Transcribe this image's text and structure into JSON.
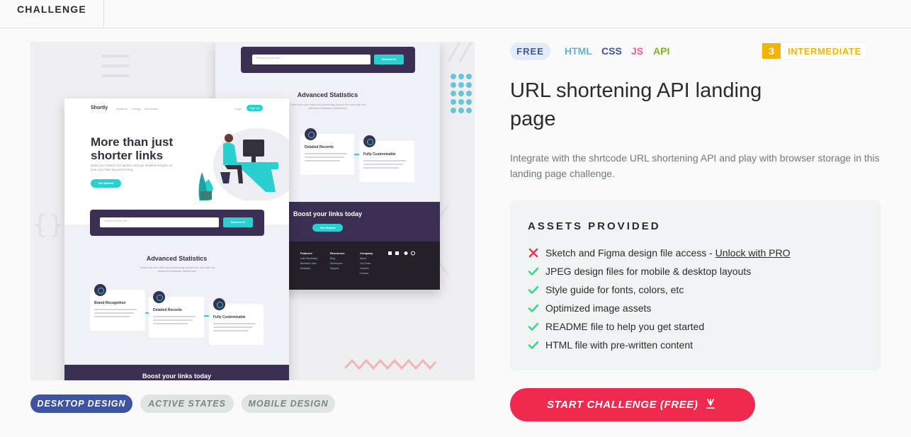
{
  "header": {
    "tab_label": "CHALLENGE"
  },
  "preview": {
    "back": {
      "input_placeholder": "Shorten a link here...",
      "shorten_button": "Shorten It!",
      "stats_title": "Advanced Statistics",
      "stats_sub": "Track how your links are performing across the web with our advanced statistics dashboard.",
      "card1_title": "Detailed Records",
      "card2_title": "Fully Customizable",
      "boost_title": "Boost your links today",
      "boost_button": "Get Started",
      "footer_cols": [
        {
          "heading": "Features",
          "links": [
            "Link Shortening",
            "Branded Links",
            "Analytics"
          ]
        },
        {
          "heading": "Resources",
          "links": [
            "Blog",
            "Developers",
            "Support"
          ]
        },
        {
          "heading": "Company",
          "links": [
            "About",
            "Our Team",
            "Careers",
            "Contact"
          ]
        }
      ]
    },
    "front": {
      "logo": "Shortly",
      "nav": [
        "Features",
        "Pricing",
        "Resources"
      ],
      "login": "Login",
      "signup": "Sign Up",
      "hero_title_1": "More than just",
      "hero_title_2": "shorter links",
      "hero_text": "Build your brand's recognition and get detailed insights on how your links are performing.",
      "hero_button": "Get Started",
      "input_placeholder": "Shorten a link here...",
      "shorten_button": "Shorten It!",
      "stats_title": "Advanced Statistics",
      "stats_sub": "Track how your links are performing across the web with our advanced statistics dashboard.",
      "card1_title": "Brand Recognition",
      "card2_title": "Detailed Records",
      "card3_title": "Fully Customizable",
      "boost_title": "Boost your links today"
    }
  },
  "design_tabs": [
    "DESKTOP DESIGN",
    "ACTIVE STATES",
    "MOBILE DESIGN"
  ],
  "tags": {
    "price": "FREE",
    "languages": [
      {
        "label": "HTML",
        "color": "#6aaece"
      },
      {
        "label": "CSS",
        "color": "#3e54a3"
      },
      {
        "label": "JS",
        "color": "#ee5a8a"
      },
      {
        "label": "API",
        "color": "#7db518"
      }
    ],
    "level_number": "3",
    "level_label": "INTERMEDIATE"
  },
  "title_line1": "URL shortening API landing",
  "title_line2": "page",
  "description": "Integrate with the shrtcode URL shortening API and play with browser storage in this landing page challenge.",
  "assets": {
    "heading": "ASSETS PROVIDED",
    "items": [
      {
        "text": "Sketch and Figma design file access - ",
        "link": "Unlock with PRO",
        "included": false
      },
      {
        "text": "JPEG design files for mobile & desktop layouts",
        "included": true
      },
      {
        "text": "Style guide for fonts, colors, etc",
        "included": true
      },
      {
        "text": "Optimized image assets",
        "included": true
      },
      {
        "text": "README file to help you get started",
        "included": true
      },
      {
        "text": "HTML file with pre-written content",
        "included": true
      }
    ]
  },
  "cta": {
    "label": "START CHALLENGE (FREE)",
    "icon": "download-icon"
  },
  "colors": {
    "accent": "#f0294f",
    "primary": "#3e54a3",
    "check": "#3ad68a",
    "cross": "#e8394f",
    "level": "#f3b408"
  }
}
